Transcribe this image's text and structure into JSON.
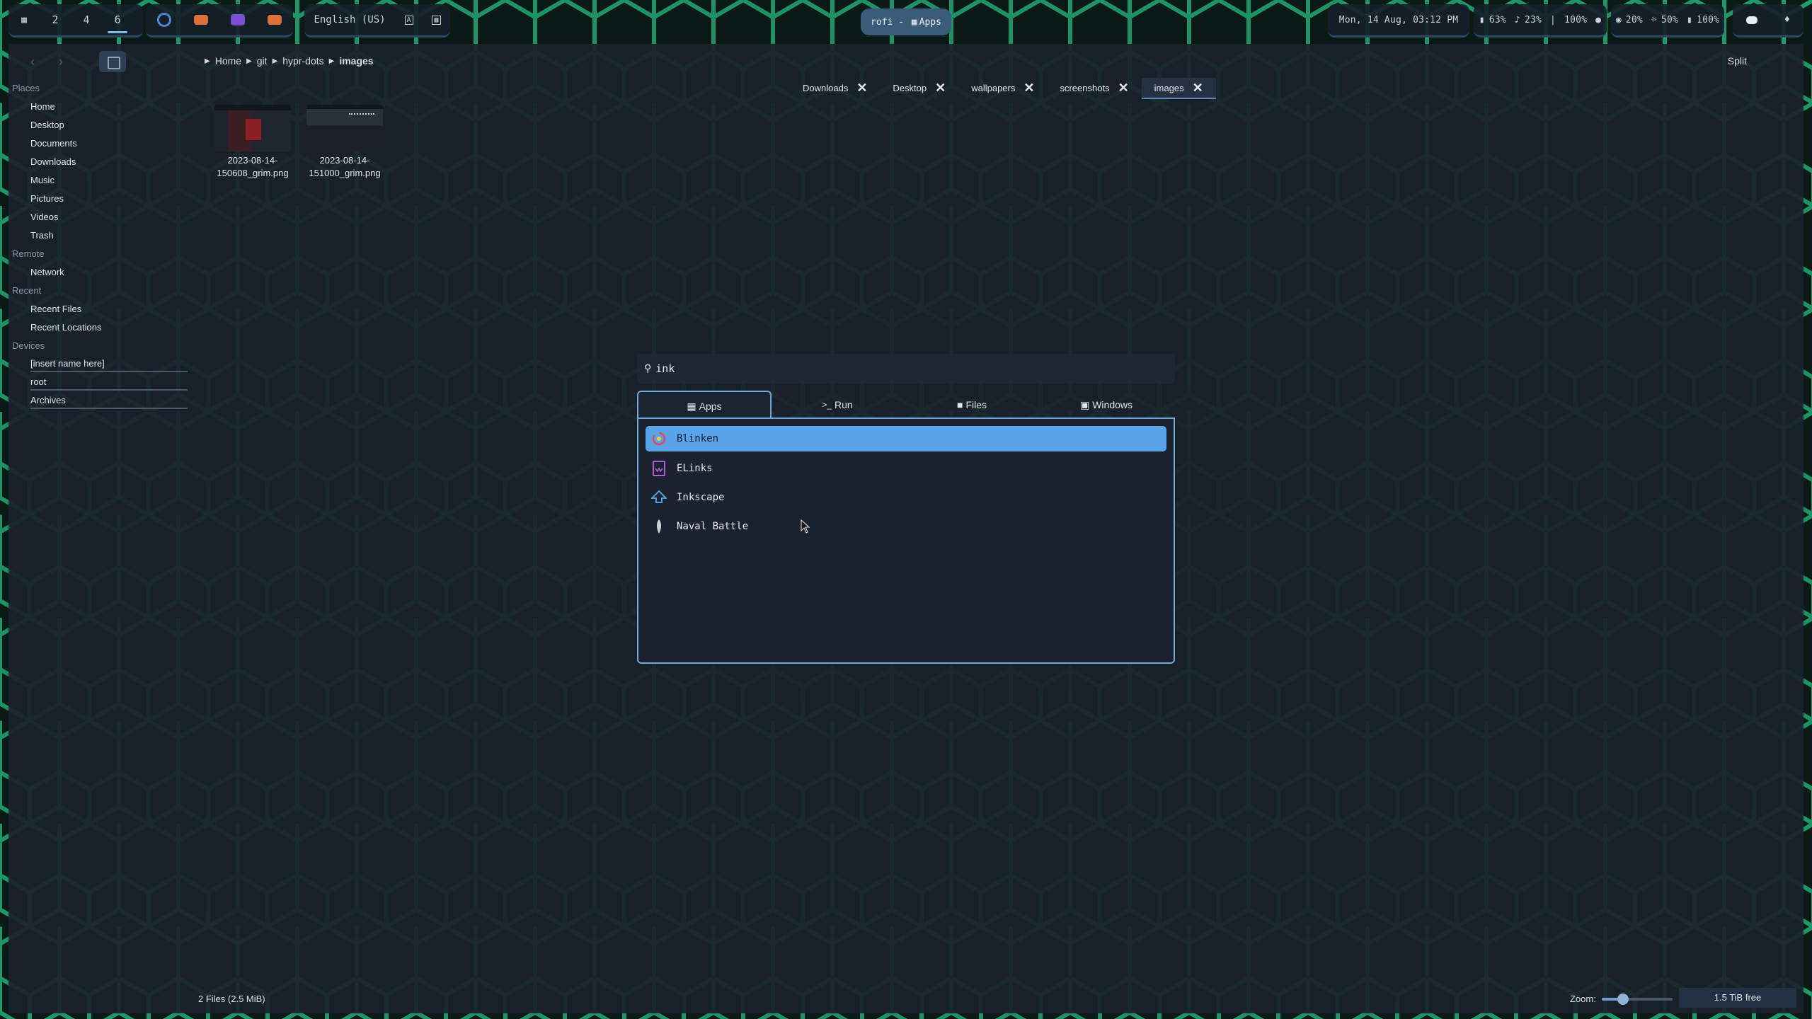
{
  "topbar": {
    "workspaces": [
      "2",
      "4",
      "6"
    ],
    "language": "English (US)",
    "center_title": "rofi - ",
    "center_mode": "Apps",
    "datetime": "Mon, 14 Aug, 03:12 PM",
    "stats": [
      "63%",
      "23%",
      "100%",
      "20%",
      "50%",
      "100%"
    ],
    "colors": {
      "accent": "#7fb6e8",
      "pill_bg": "#3a5c7a"
    }
  },
  "filemanager": {
    "breadcrumb": [
      "Home",
      "git",
      "hypr-dots",
      "images"
    ],
    "split_label": "Split",
    "sidebar": {
      "places_header": "Places",
      "places": [
        "Home",
        "Desktop",
        "Documents",
        "Downloads",
        "Music",
        "Pictures",
        "Videos",
        "Trash"
      ],
      "remote_header": "Remote",
      "remote": [
        "Network"
      ],
      "recent_header": "Recent",
      "recent": [
        "Recent Files",
        "Recent Locations"
      ],
      "devices_header": "Devices",
      "devices": [
        "[insert name here]",
        "root",
        "Archives"
      ]
    },
    "tabs": [
      {
        "label": "Downloads"
      },
      {
        "label": "Desktop"
      },
      {
        "label": "wallpapers"
      },
      {
        "label": "screenshots"
      },
      {
        "label": "images",
        "active": true
      }
    ],
    "files": [
      {
        "line1": "2023-08-14-",
        "line2": "150608_grim.png"
      },
      {
        "line1": "2023-08-14-",
        "line2": "151000_grim.png"
      }
    ],
    "status": "2 Files (2.5 MiB)",
    "zoom_label": "Zoom:",
    "zoom_level": 0.3,
    "free_space": "1.5 TiB free"
  },
  "launcher": {
    "query": "ink",
    "modes": [
      "Apps",
      "Run",
      "Files",
      "Windows"
    ],
    "active_mode": "Apps",
    "results": [
      {
        "name": "Blinken",
        "icon": "blinken-icon",
        "selected": true
      },
      {
        "name": "ELinks",
        "icon": "elinks-icon"
      },
      {
        "name": "Inkscape",
        "icon": "inkscape-icon"
      },
      {
        "name": "Naval Battle",
        "icon": "naval-battle-icon"
      }
    ]
  }
}
